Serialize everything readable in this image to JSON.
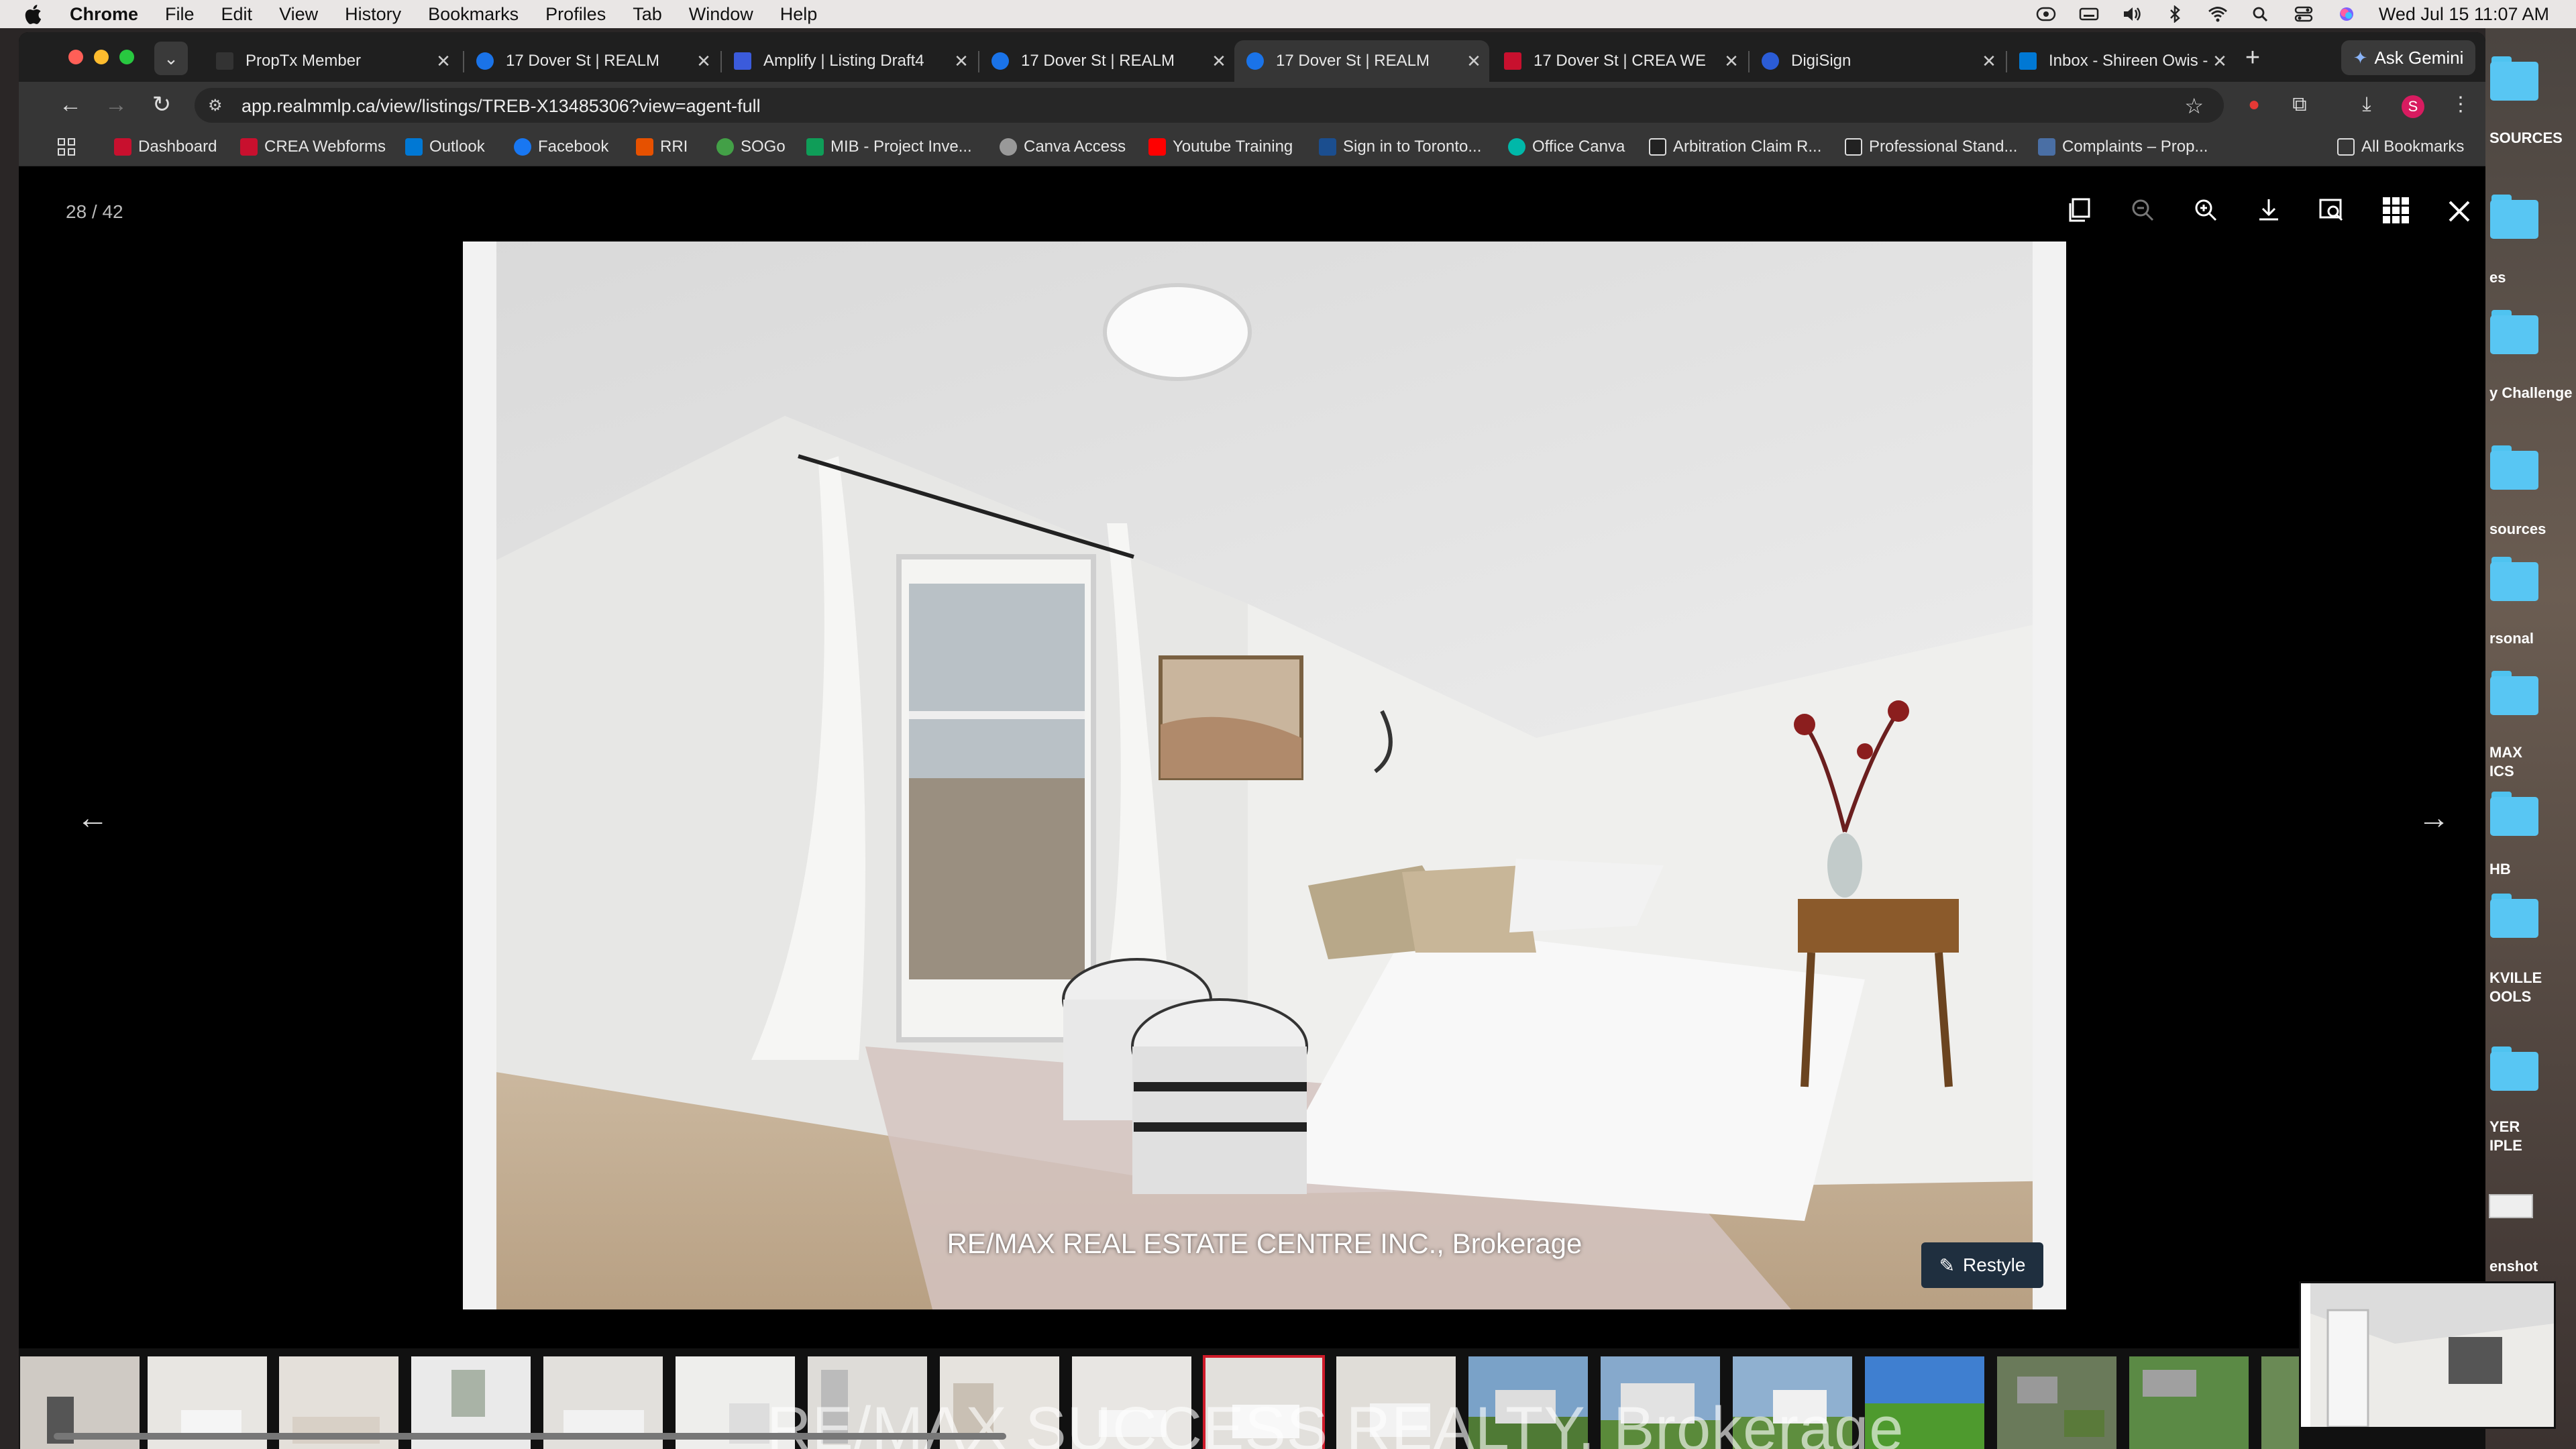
{
  "menubar": {
    "app": "Chrome",
    "items": [
      "File",
      "Edit",
      "View",
      "History",
      "Bookmarks",
      "Profiles",
      "Tab",
      "Window",
      "Help"
    ],
    "datetime": "Wed Jul 15  11:07 AM"
  },
  "desktop": {
    "folders": [
      "SOURCES",
      "es",
      "y Challenge",
      "sources",
      "rsonal",
      "MAX",
      "ICS",
      "HB",
      "KVILLE",
      "OOLS",
      "YER",
      "IPLE",
      "enshot"
    ],
    "folder_color": "#58c6f3"
  },
  "tabs": [
    {
      "title": "PropTx Member",
      "active": false
    },
    {
      "title": "17 Dover St | REALM",
      "active": false
    },
    {
      "title": "Amplify | Listing Draft4",
      "active": false
    },
    {
      "title": "17 Dover St | REALM",
      "active": false
    },
    {
      "title": "17 Dover St | REALM",
      "active": true
    },
    {
      "title": "17 Dover St | CREA WE",
      "active": false
    },
    {
      "title": "DigiSign",
      "active": false
    },
    {
      "title": "Inbox - Shireen Owis -",
      "active": false
    }
  ],
  "gemini_label": "Ask Gemini",
  "address": {
    "url": "app.realmmlp.ca/view/listings/TREB-X13485306?view=agent-full"
  },
  "profile_initial": "S",
  "bookmarks": [
    "Dashboard",
    "CREA Webforms",
    "Outlook",
    "Facebook",
    "RRI",
    "SOGo",
    "MIB - Project Inve...",
    "Canva Access",
    "Youtube Training",
    "Sign in to Toronto...",
    "Office Canva",
    "Arbitration Claim R...",
    "Professional Stand...",
    "Complaints – Prop..."
  ],
  "all_bookmarks": "All Bookmarks",
  "viewer": {
    "counter": "28 / 42",
    "caption": "RE/MAX REAL ESTATE CENTRE INC., Brokerage",
    "restyle_label": "Restyle",
    "watermark": "RE/MAX SUCCESS REALTY, Brokerage",
    "thumbnail_count": 17,
    "selected_thumbnail": 10,
    "accent_color": "#d01b2a"
  }
}
